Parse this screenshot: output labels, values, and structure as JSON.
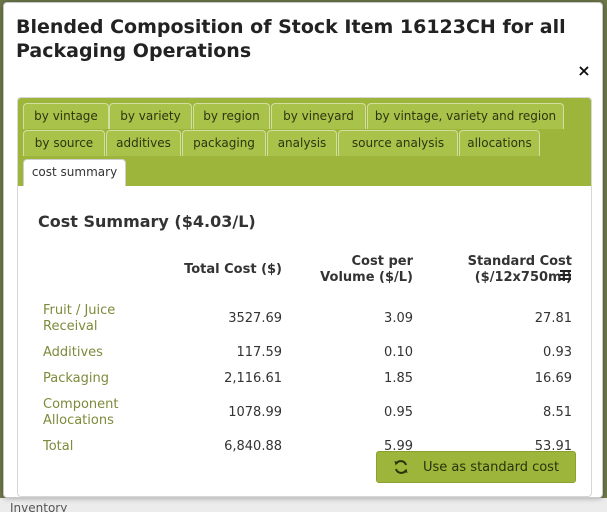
{
  "background": {
    "footer_text": "Inventory"
  },
  "dialog": {
    "title": "Blended Composition of Stock Item 16123CH for all Packaging Operations",
    "close_symbol": "×"
  },
  "tabs": [
    {
      "label": "by vintage"
    },
    {
      "label": "by variety"
    },
    {
      "label": "by region"
    },
    {
      "label": "by vineyard"
    },
    {
      "label": "by vintage, variety and region"
    },
    {
      "label": "by source"
    },
    {
      "label": "additives"
    },
    {
      "label": "packaging"
    },
    {
      "label": "analysis"
    },
    {
      "label": "source analysis"
    },
    {
      "label": "allocations"
    },
    {
      "label": "cost summary",
      "active": true
    }
  ],
  "cost_summary": {
    "title": "Cost Summary ($4.03/L)",
    "columns": {
      "total_cost": "Total Cost ($)",
      "cost_per_volume": "Cost per Volume ($/L)",
      "standard_cost": "Standard Cost ($/12x750ml)"
    },
    "rows": [
      {
        "label": "Fruit / Juice Receival",
        "total": "3527.69",
        "per_volume": "3.09",
        "standard": "27.81"
      },
      {
        "label": "Additives",
        "total": "117.59",
        "per_volume": "0.10",
        "standard": "0.93"
      },
      {
        "label": "Packaging",
        "total": "2,116.61",
        "per_volume": "1.85",
        "standard": "16.69"
      },
      {
        "label": "Component Allocations",
        "total": "1078.99",
        "per_volume": "0.95",
        "standard": "8.51"
      },
      {
        "label": "Total",
        "total": "6,840.88",
        "per_volume": "5.99",
        "standard": "53.91"
      }
    ],
    "button_label": "Use as standard cost"
  },
  "colors": {
    "accent": "#9cb53a",
    "row_label": "#7d8a3a"
  }
}
